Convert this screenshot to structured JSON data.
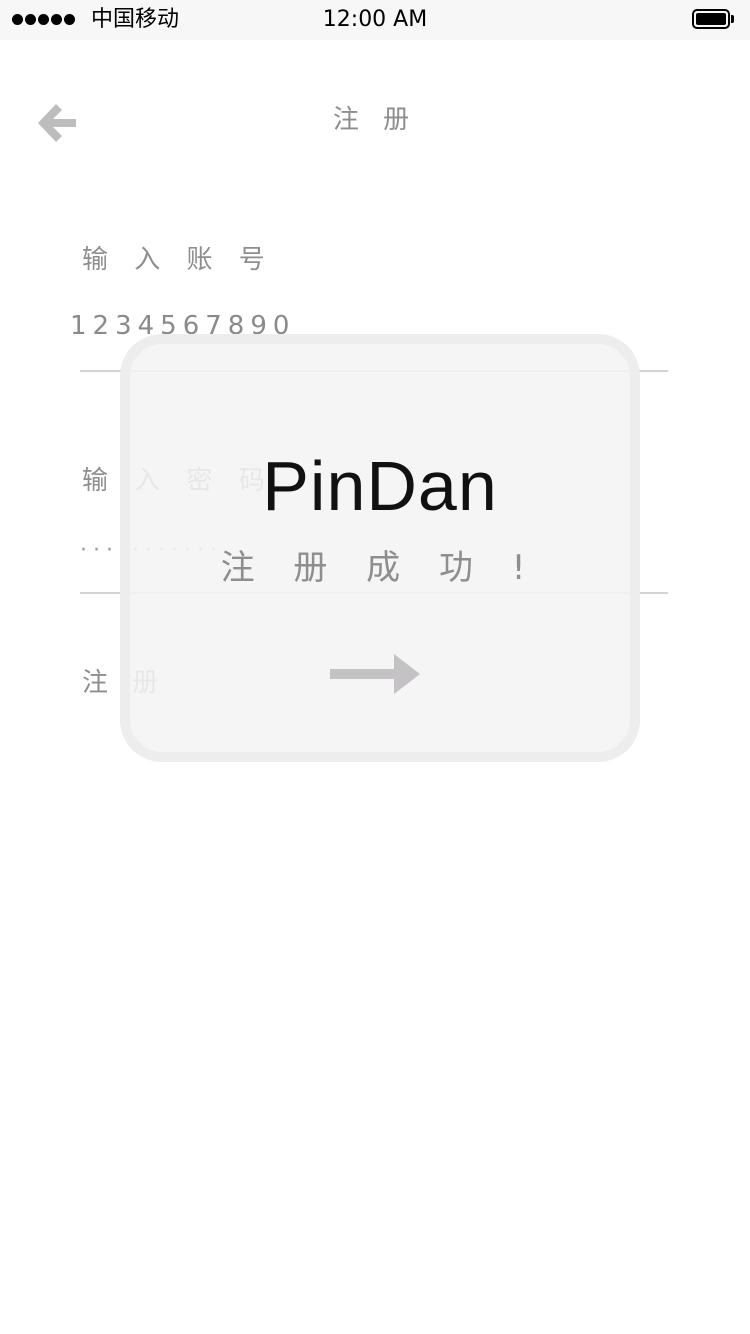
{
  "status_bar": {
    "carrier": "中国移动",
    "time": "12:00 AM",
    "signal_bars": 5
  },
  "nav": {
    "title": "注 册",
    "back_icon": "back-arrow-icon"
  },
  "form": {
    "account_label": "输 入 账 号",
    "account_value": "1234567890",
    "password_label": "输 入 密 码",
    "password_value": "···········",
    "register_link": "注 册"
  },
  "popup": {
    "brand": "PinDan",
    "message": "注 册 成 功 !",
    "arrow_icon": "right-arrow-icon"
  },
  "colors": {
    "text_gray": "#8e8e8e",
    "divider": "#d3d3d3",
    "icon_gray": "#bdbdbd",
    "popup_bg": "#f4f4f4",
    "brand_text": "#111111",
    "status_bar_bg": "#f7f7f7"
  }
}
